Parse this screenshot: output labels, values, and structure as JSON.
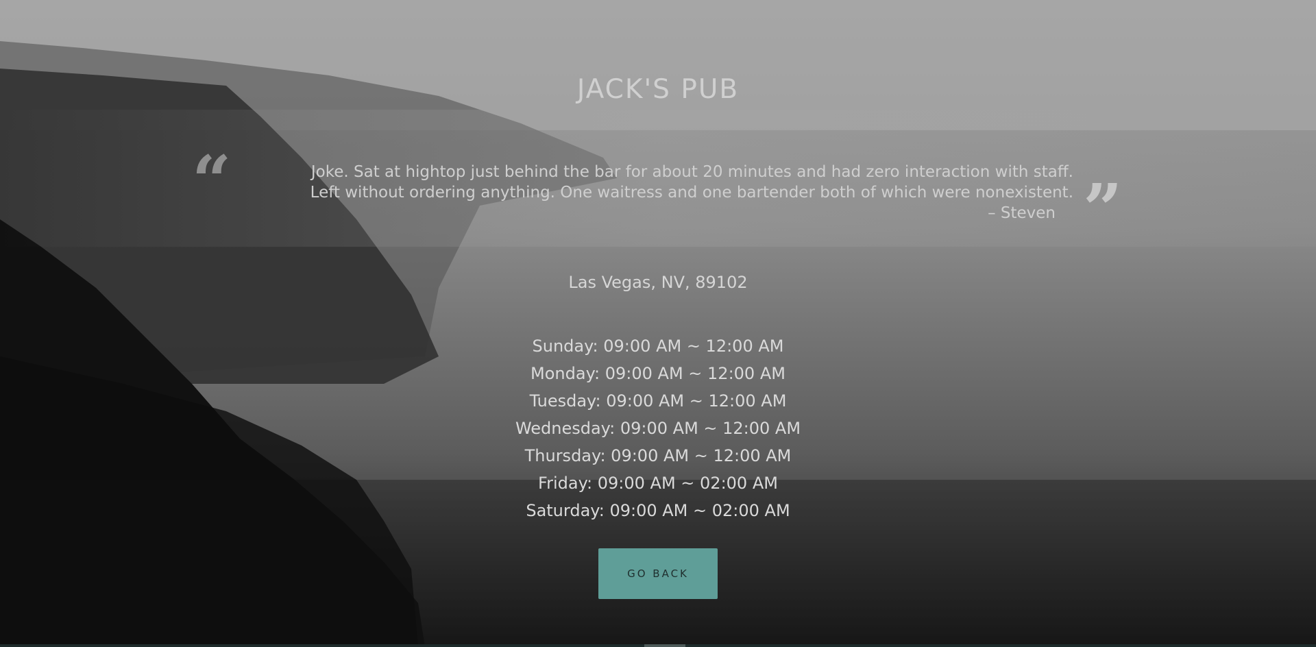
{
  "header": {
    "title": "JACK'S PUB"
  },
  "review": {
    "open_quote": "“",
    "close_quote": "”",
    "text_line1": "Joke. Sat at hightop just behind the bar for about 20 minutes and had zero interaction with staff.",
    "text_line2": "Left without ordering anything. One waitress and one bartender both of which were nonexistent.",
    "author": "– Steven"
  },
  "location": {
    "address": "Las Vegas, NV, 89102"
  },
  "hours": [
    "Sunday: 09:00 AM ~ 12:00 AM",
    "Monday: 09:00 AM ~ 12:00 AM",
    "Tuesday: 09:00 AM ~ 12:00 AM",
    "Wednesday: 09:00 AM ~ 12:00 AM",
    "Thursday: 09:00 AM ~ 12:00 AM",
    "Friday: 09:00 AM ~ 02:00 AM",
    "Saturday: 09:00 AM ~ 02:00 AM"
  ],
  "actions": {
    "go_back_label": "GO BACK"
  },
  "colors": {
    "accent": "#5f9e98",
    "text": "#d6d6d6"
  }
}
